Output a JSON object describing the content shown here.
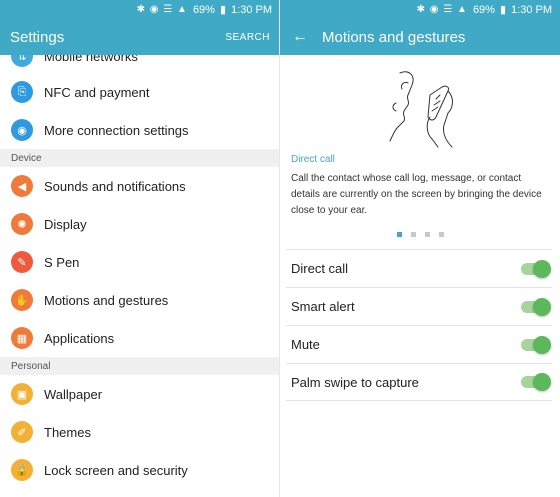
{
  "status": {
    "battery": "69%",
    "time": "1:30 PM",
    "signal_glyphs": "✱ ◉ ☰ ▲"
  },
  "left": {
    "title": "Settings",
    "search_label": "SEARCH",
    "top_partial": {
      "label": "Mobile networks",
      "icon": "mobile-networks-icon",
      "color": "#3fa9e0"
    },
    "items_top": [
      {
        "label": "NFC and payment",
        "icon": "nfc-icon",
        "glyph": "⎘",
        "color": "#2f9ae0"
      },
      {
        "label": "More connection settings",
        "icon": "connections-icon",
        "glyph": "◉",
        "color": "#2f9ae0"
      }
    ],
    "section_device": "Device",
    "items_device": [
      {
        "label": "Sounds and notifications",
        "icon": "sound-icon",
        "glyph": "◀",
        "color": "#f07a3a"
      },
      {
        "label": "Display",
        "icon": "display-icon",
        "glyph": "✺",
        "color": "#f07a3a"
      },
      {
        "label": "S Pen",
        "icon": "pen-icon",
        "glyph": "✎",
        "color": "#ef5a3c"
      },
      {
        "label": "Motions and gestures",
        "icon": "motion-icon",
        "glyph": "✋",
        "color": "#f07a3a"
      },
      {
        "label": "Applications",
        "icon": "apps-icon",
        "glyph": "▦",
        "color": "#f07a3a"
      }
    ],
    "section_personal": "Personal",
    "items_personal": [
      {
        "label": "Wallpaper",
        "icon": "wallpaper-icon",
        "glyph": "▣",
        "color": "#f2b134"
      },
      {
        "label": "Themes",
        "icon": "themes-icon",
        "glyph": "✐",
        "color": "#f2b134"
      },
      {
        "label": "Lock screen and security",
        "icon": "lock-icon",
        "glyph": "🔒",
        "color": "#f2b134"
      }
    ]
  },
  "right": {
    "title": "Motions and gestures",
    "back_glyph": "←",
    "desc_title": "Direct call",
    "desc": "Call the contact whose call log, message, or contact details are currently on the screen by bringing the device close to your ear.",
    "page_dots": {
      "count": 4,
      "active": 0
    },
    "toggles": [
      {
        "label": "Direct call",
        "on": true
      },
      {
        "label": "Smart alert",
        "on": true
      },
      {
        "label": "Mute",
        "on": true
      },
      {
        "label": "Palm swipe to capture",
        "on": true
      }
    ]
  }
}
